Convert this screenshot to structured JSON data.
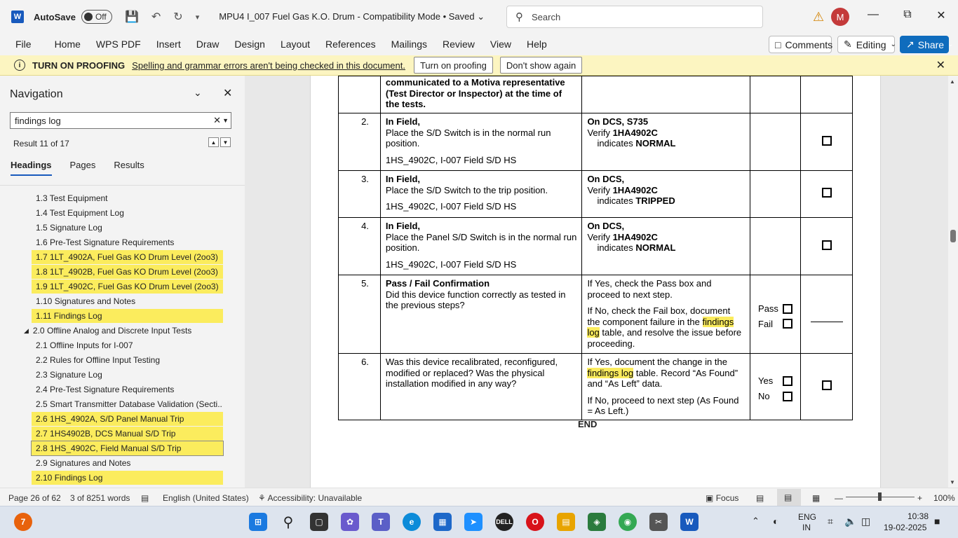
{
  "titlebar": {
    "app_letter": "W",
    "autosave_label": "AutoSave",
    "autosave_state": "Off",
    "doc_title": "MPU4 I_007 Fuel Gas K.O. Drum  -  Compatibility Mode • Saved",
    "search_placeholder": "Search",
    "avatar_initial": "M"
  },
  "ribbon": {
    "tabs": [
      "File",
      "Home",
      "WPS PDF",
      "Insert",
      "Draw",
      "Design",
      "Layout",
      "References",
      "Mailings",
      "Review",
      "View",
      "Help"
    ],
    "comments_label": "Comments",
    "editing_label": "Editing",
    "share_label": "Share"
  },
  "message_bar": {
    "title": "TURN ON PROOFING",
    "text": "Spelling and grammar errors aren't being checked in this document.",
    "button_1": "Turn on proofing",
    "button_2": "Don't show again"
  },
  "nav": {
    "title": "Navigation",
    "search_value": "findings log",
    "result_text": "Result 11 of 17",
    "tabs": [
      "Headings",
      "Pages",
      "Results"
    ],
    "items": [
      {
        "label": "1.3 Test Equipment",
        "hl": false
      },
      {
        "label": "1.4 Test Equipment Log",
        "hl": false
      },
      {
        "label": "1.5 Signature Log",
        "hl": false
      },
      {
        "label": "1.6 Pre-Test Signature Requirements",
        "hl": false
      },
      {
        "label": "1.7 1LT_4902A, Fuel Gas KO Drum Level (2oo3)",
        "hl": true
      },
      {
        "label": "1.8 1LT_4902B, Fuel Gas KO Drum Level (2oo3)",
        "hl": true
      },
      {
        "label": "1.9 1LT_4902C, Fuel Gas KO Drum Level (2oo3)",
        "hl": true
      },
      {
        "label": "1.10 Signatures and Notes",
        "hl": false
      },
      {
        "label": "1.11 Findings Log",
        "hl": true
      },
      {
        "label": "2.0 Offline Analog and Discrete Input Tests",
        "hl": false,
        "level1": true
      },
      {
        "label": "2.1 Offline Inputs for I-007",
        "hl": false
      },
      {
        "label": "2.2 Rules for Offline Input Testing",
        "hl": false
      },
      {
        "label": "2.3 Signature Log",
        "hl": false
      },
      {
        "label": "2.4 Pre-Test Signature Requirements",
        "hl": false
      },
      {
        "label": "2.5 Smart Transmitter Database Validation (Secti...",
        "hl": false
      },
      {
        "label": "2.6 1HS_4902A, S/D Panel Manual Trip",
        "hl": true
      },
      {
        "label": "2.7 1HS4902B, DCS Manual S/D Trip",
        "hl": true
      },
      {
        "label": "2.8 1HS_4902C, Field Manual S/D Trip",
        "hl": true,
        "sel": true
      },
      {
        "label": "2.9 Signatures and Notes",
        "hl": false
      },
      {
        "label": "2.10 Findings Log",
        "hl": true
      }
    ]
  },
  "doc": {
    "row0": {
      "proc": "communicated to a Motiva representative (Test Director or Inspector) at the time of the tests."
    },
    "row2": {
      "num": "2.",
      "p1": "In Field,",
      "p2": "Place the S/D Switch is in the normal run position.",
      "p3": "1HS_4902C, I-007 Field S/D HS",
      "v1": "On DCS, S735",
      "v2a": "Verify ",
      "v2b": "1HA4902C",
      "v3a": "indicates ",
      "v3b": "NORMAL"
    },
    "row3": {
      "num": "3.",
      "p1": "In Field,",
      "p2": "Place the S/D Switch to the trip position.",
      "p3": "1HS_4902C, I-007 Field S/D HS",
      "v1": "On DCS,",
      "v2a": "Verify ",
      "v2b": "1HA4902C",
      "v3a": "indicates ",
      "v3b": "TRIPPED"
    },
    "row4": {
      "num": "4.",
      "p1": "In Field,",
      "p2": "Place the Panel S/D Switch is in the normal run position.",
      "p3": "1HS_4902C, I-007 Field S/D HS",
      "v1": "On DCS,",
      "v2a": "Verify ",
      "v2b": "1HA4902C",
      "v3a": "indicates ",
      "v3b": "NORMAL"
    },
    "row5": {
      "num": "5.",
      "p1": "Pass / Fail Confirmation",
      "p2": "Did this device function correctly as tested in the previous steps?",
      "v1": "If Yes, check the Pass box and proceed to next step.",
      "v2a": "If No, check the Fail box, document the component failure in the ",
      "v2b": "findings log",
      "v2c": " table, and resolve the issue before proceeding.",
      "r1": "Pass",
      "r2": "Fail"
    },
    "row6": {
      "num": "6.",
      "p1": "Was this device recalibrated, reconfigured, modified or replaced?  Was the physical installation modified in any way?",
      "v1a": "If Yes, document the change in the ",
      "v1b": "findings log",
      "v1c": " table.  Record “As Found” and “As Left” data.",
      "v2": "If No, proceed to next step (As Found = As Left.)",
      "r1": "Yes",
      "r2": "No"
    },
    "end": "END"
  },
  "status": {
    "page": "Page 26 of 62",
    "words": "3 of 8251 words",
    "language": "English (United States)",
    "accessibility": "Accessibility: Unavailable",
    "focus": "Focus",
    "zoom": "100%"
  },
  "taskbar": {
    "notif_count": "7",
    "lang_1": "ENG",
    "lang_2": "IN",
    "time": "10:38",
    "date": "19-02-2025"
  }
}
